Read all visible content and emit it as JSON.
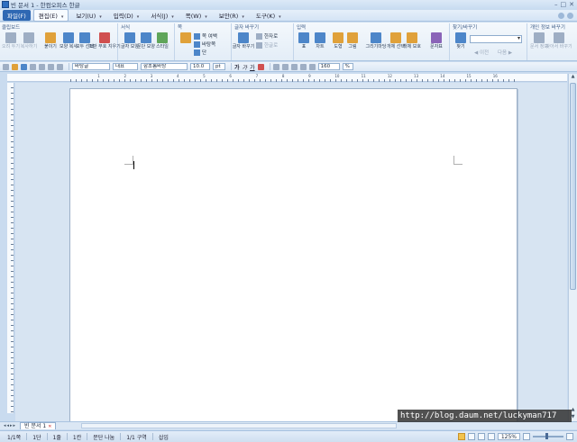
{
  "window": {
    "title": "빈 문서 1 - 한컴오피스 한글",
    "controls": [
      "–",
      "□",
      "✕"
    ]
  },
  "menu": {
    "items": [
      {
        "label": "파일(F)"
      },
      {
        "label": "편집(E)"
      },
      {
        "label": "보기(U)"
      },
      {
        "label": "입력(D)"
      },
      {
        "label": "서식(J)"
      },
      {
        "label": "쪽(W)"
      },
      {
        "label": "보안(R)"
      },
      {
        "label": "도구(K)"
      }
    ]
  },
  "ribbon": {
    "clipboard": {
      "title": "클립보드",
      "buttons": [
        "오려 두기",
        "복사하기",
        "붙이기",
        "모양 복사",
        "모두 선택",
        "조판 부호 지우기"
      ]
    },
    "format": {
      "title": "서식",
      "buttons": [
        "글자 모양",
        "문단 모양",
        "스타일"
      ]
    },
    "page": {
      "title": "쪽",
      "buttons": [
        "쪽 여백",
        "바탕쪽",
        "단"
      ]
    },
    "charinput": {
      "title": "글자 바꾸기",
      "buttons": [
        "글자 바꾸기",
        "한자로",
        "한글로"
      ]
    },
    "insert": {
      "title": "입력",
      "buttons": [
        "표",
        "차트",
        "도형",
        "그림",
        "그리기마당",
        "개체 선택",
        "개체 보호",
        "문자표"
      ]
    },
    "find": {
      "title": "찾기/바꾸기",
      "buttons": [
        "찾기"
      ],
      "prev": "◀ 이전",
      "next": "다음 ▶"
    },
    "docinfo": {
      "title": "개인 정보 바꾸기",
      "buttons": [
        "문서 정보",
        "찾아서 바꾸기"
      ]
    }
  },
  "format_toolbar": {
    "style": "바탕글",
    "lang": "대표",
    "font": "함초롬바탕",
    "size": "10.0",
    "unit": "pt",
    "bold": "가",
    "italic": "가",
    "underline": "가",
    "line_spacing": "160",
    "line_unit": "%"
  },
  "ruler": {
    "numbers": [
      "",
      "1",
      "2",
      "3",
      "4",
      "5",
      "6",
      "7",
      "8",
      "9",
      "10",
      "11",
      "12",
      "13",
      "14",
      "15",
      "16"
    ]
  },
  "tabs": {
    "nav": "◂◂▸▸",
    "document_tab": "빈 문서 1"
  },
  "status": {
    "page": "1/1쪽",
    "section": "1단",
    "line": "1줄",
    "column": "1칸",
    "mode": "문단 나눔",
    "area": "1/1 구역",
    "insert": "삽입",
    "zoom": "125%"
  },
  "watermark": "http://blog.daum.net/luckyman717",
  "colors": {
    "accent": "#2f68b3",
    "background": "#c9dbef",
    "page": "#ffffff"
  }
}
